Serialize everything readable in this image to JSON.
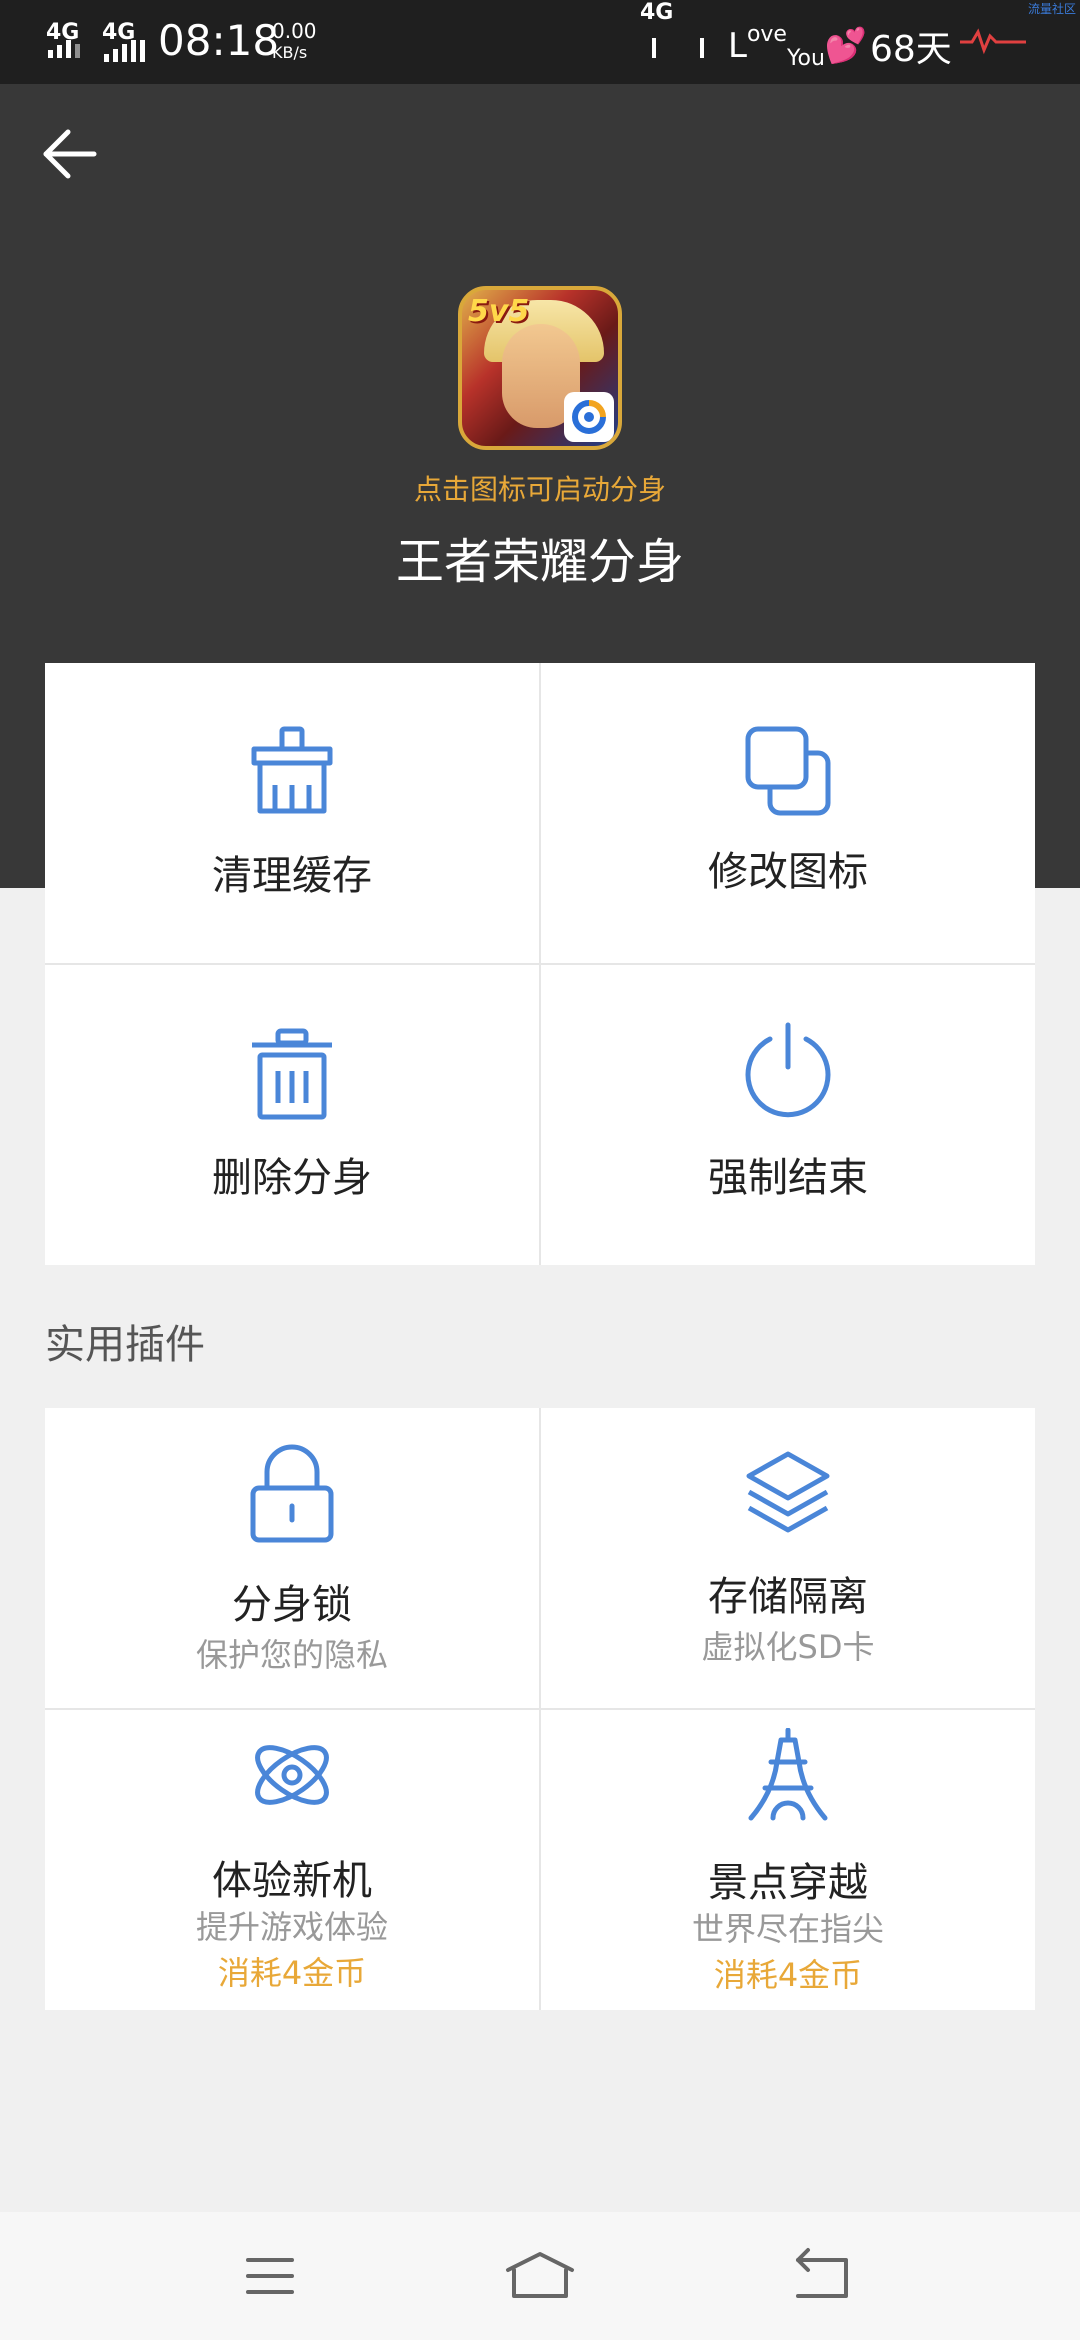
{
  "status_bar": {
    "sig1": "4G",
    "sig2": "4G",
    "time": "08:18",
    "speed_value": "0.00",
    "speed_unit": "KB/s",
    "right_net": "4G",
    "love_l": "L",
    "love_ove": "ove",
    "love_you": "You",
    "heart": "💕",
    "days": "68天",
    "corner": "流量社区"
  },
  "header": {
    "hint": "点击图标可启动分身",
    "app_title": "王者荣耀分身",
    "icon_tag": "5v5"
  },
  "actions": [
    {
      "label": "清理缓存",
      "icon": "broom-icon"
    },
    {
      "label": "修改图标",
      "icon": "copy-icon"
    },
    {
      "label": "删除分身",
      "icon": "trash-icon"
    },
    {
      "label": "强制结束",
      "icon": "power-icon"
    }
  ],
  "plugins_section": {
    "title": "实用插件"
  },
  "plugins": [
    {
      "label": "分身锁",
      "sub": "保护您的隐私",
      "icon": "lock-icon"
    },
    {
      "label": "存储隔离",
      "sub": "虚拟化SD卡",
      "icon": "layers-icon"
    },
    {
      "label": "体验新机",
      "sub": "提升游戏体验",
      "cost": "消耗4金币",
      "icon": "atom-icon"
    },
    {
      "label": "景点穿越",
      "sub": "世界尽在指尖",
      "cost": "消耗4金币",
      "icon": "eiffel-tower-icon"
    }
  ],
  "colors": {
    "accent": "#4a86d8",
    "gold": "#e8a838",
    "header_bg": "#383838"
  }
}
